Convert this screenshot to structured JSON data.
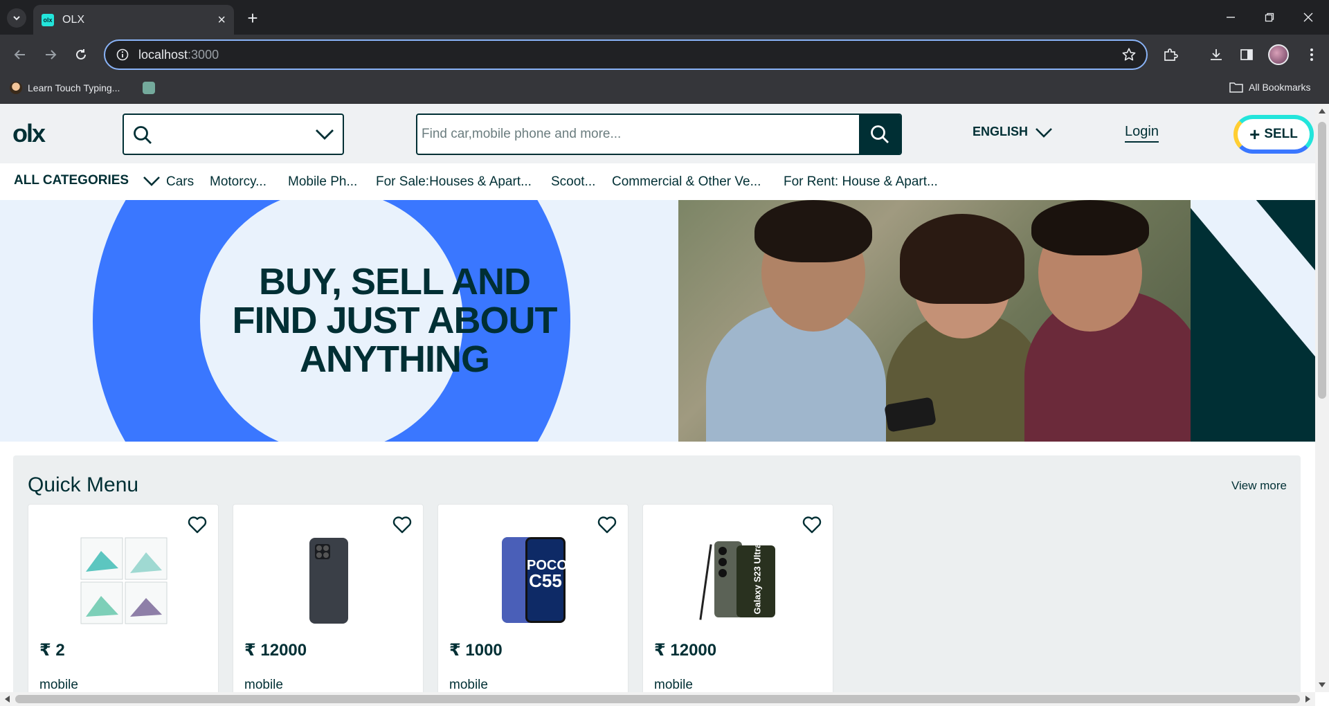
{
  "browser": {
    "tab_title": "OLX",
    "tab_favicon_text": "olx",
    "url_host": "localhost",
    "url_port": ":3000",
    "bookmarks": [
      {
        "label": "Learn Touch Typing..."
      },
      {
        "label": ""
      }
    ],
    "all_bookmarks_label": "All Bookmarks"
  },
  "header": {
    "logo": "olx",
    "search_placeholder": "Find car,mobile phone and more...",
    "language": "ENGLISH",
    "login": "Login",
    "sell": "SELL",
    "sell_plus": "+"
  },
  "categories": {
    "all": "ALL CATEGORIES",
    "items": [
      "Cars",
      "Motorcy...",
      "Mobile Ph...",
      "For Sale:Houses & Apart...",
      "Scoot...",
      "Commercial & Other Ve...",
      "For Rent: House & Apart..."
    ]
  },
  "banner": {
    "line1": "BUY, SELL AND",
    "line2": "FIND JUST ABOUT",
    "line3": "ANYTHING"
  },
  "quick_menu": {
    "title": "Quick Menu",
    "view_more": "View more",
    "cards": [
      {
        "price": "₹ 2",
        "category": "mobile",
        "image": "product-collage"
      },
      {
        "price": "₹ 12000",
        "category": "mobile",
        "image": "phone-dark"
      },
      {
        "price": "₹ 1000",
        "category": "mobile",
        "image": "phone-poco-c55"
      },
      {
        "price": "₹ 12000",
        "category": "mobile",
        "image": "phone-galaxy-s23-ultra"
      }
    ],
    "poco_text": "POCO",
    "poco_model": "C55",
    "galaxy_text": "Galaxy S23 Ultra"
  },
  "colors": {
    "brand_dark": "#002f34",
    "brand_blue": "#3a77ff",
    "brand_teal": "#23e5db",
    "brand_yellow": "#ffce32"
  }
}
